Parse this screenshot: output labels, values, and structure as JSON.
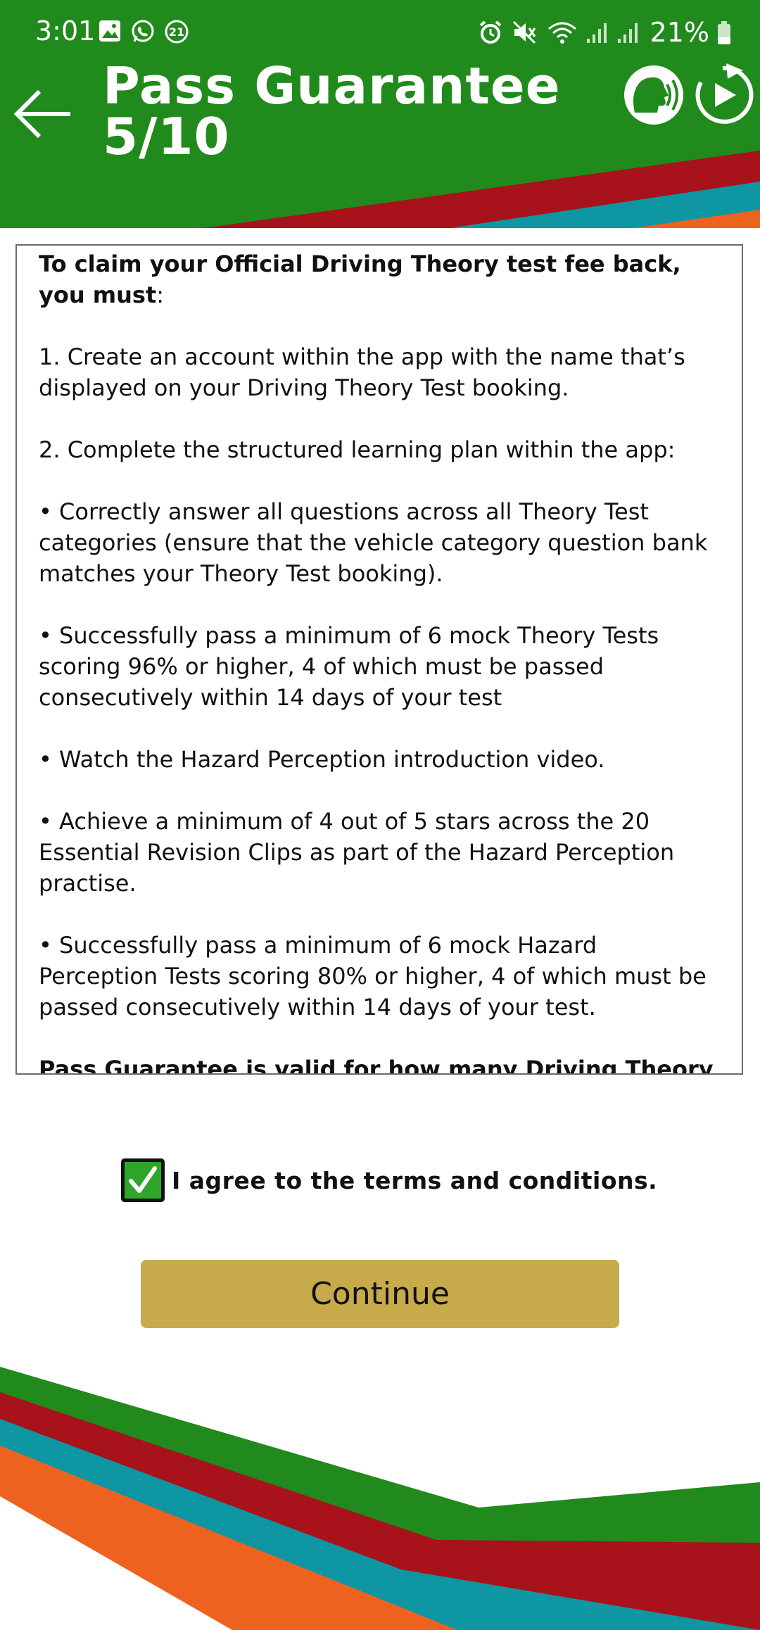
{
  "status_bar": {
    "time": "3:01",
    "notification_badge": "21",
    "battery_percent": "21%"
  },
  "header": {
    "title_line1": "Pass Guarantee",
    "title_line2": "5/10"
  },
  "terms": {
    "lead_bold": "To claim your Official Driving Theory test fee back, you must",
    "lead_colon": ":",
    "items": [
      "1. Create an account within the app with the name that’s displayed on your Driving Theory Test booking.",
      "2. Complete the structured learning plan within the app:",
      "• Correctly answer all questions across all Theory Test categories (ensure that the vehicle category question bank matches your Theory Test booking).",
      "• Successfully pass a minimum of 6 mock Theory Tests scoring 96% or higher, 4 of which must be passed consecutively within 14 days of your test",
      "• Watch the Hazard Perception introduction video.",
      "• Achieve a minimum of 4 out of 5 stars across the 20 Essential Revision Clips as part of the Hazard Perception practise.",
      "• Successfully pass a minimum of 6 mock Hazard Perception Tests scoring 80% or higher, 4 of which must be passed consecutively within 14 days of your test."
    ],
    "cut_off_line": "Pass Guarantee is valid for how many Driving Theory"
  },
  "agreement": {
    "checked": true,
    "label": "I agree to the terms and conditions."
  },
  "continue_button": {
    "label": "Continue"
  },
  "colors": {
    "header_green": "#218a1c",
    "stripe_red": "#a8121a",
    "stripe_teal": "#0e96a3",
    "stripe_orange": "#ee6220",
    "button_gold": "#c7ab4b",
    "checkbox_green": "#2fa52a"
  }
}
